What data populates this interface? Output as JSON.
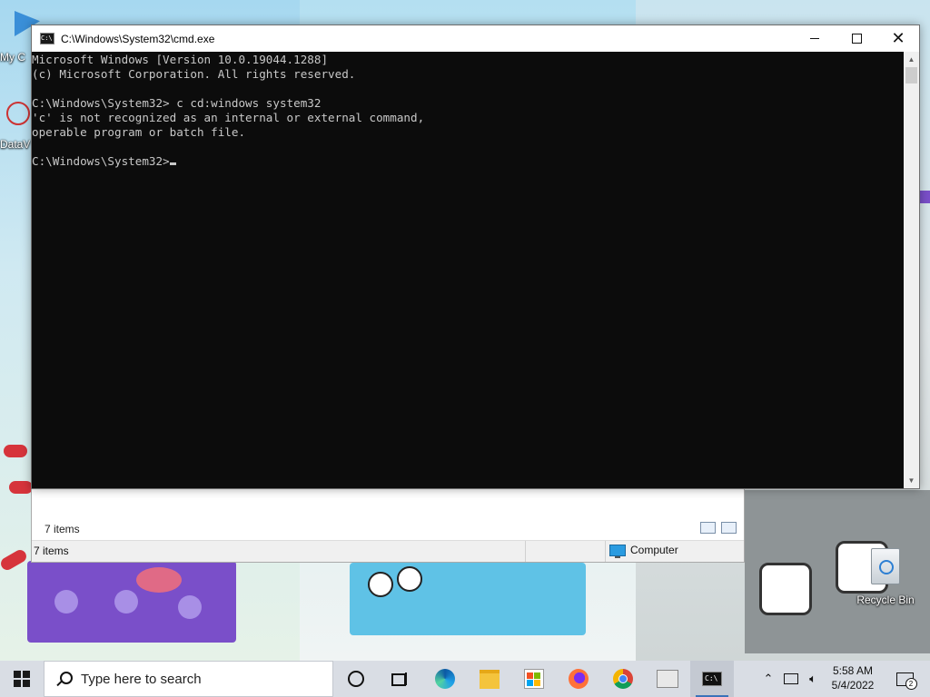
{
  "desktop": {
    "icons": [
      {
        "label": "My C"
      },
      {
        "label": "DataV"
      },
      {
        "label": "Recycle Bin"
      }
    ]
  },
  "cmd_window": {
    "title": "C:\\Windows\\System32\\cmd.exe",
    "lines": [
      "Microsoft Windows [Version 10.0.19044.1288]",
      "(c) Microsoft Corporation. All rights reserved.",
      "",
      "C:\\Windows\\System32> c cd:windows system32",
      "'c' is not recognized as an internal or external command,",
      "operable program or batch file.",
      ""
    ],
    "prompt": "C:\\Windows\\System32>"
  },
  "explorer_window": {
    "status_items": "7 items",
    "bottom_items": "7 items",
    "location": "Computer"
  },
  "taskbar": {
    "search_placeholder": "Type here to search",
    "time": "5:58 AM",
    "date": "5/4/2022",
    "notification_count": "2",
    "apps": [
      "cortana",
      "task-view",
      "edge",
      "file-explorer",
      "store",
      "firefox",
      "chrome",
      "photos",
      "command-prompt"
    ]
  },
  "colors": {
    "console_bg": "#0c0c0c",
    "console_text": "#c8c8c8",
    "taskbar_bg": "#d9dde4"
  }
}
